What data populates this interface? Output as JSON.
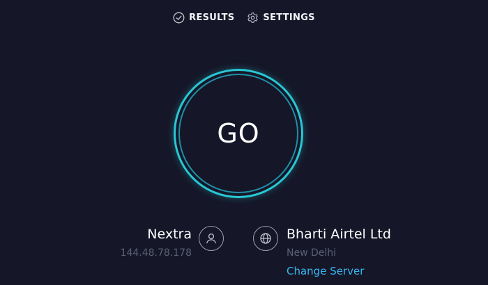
{
  "nav": {
    "results_label": "RESULTS",
    "settings_label": "SETTINGS",
    "results_icon": "check-circle-icon",
    "settings_icon": "gear-icon"
  },
  "go_button": {
    "label": "GO"
  },
  "client": {
    "isp_name": "Nextra",
    "ip_address": "144.48.78.178",
    "icon": "user-icon"
  },
  "server": {
    "name": "Bharti Airtel Ltd",
    "location": "New Delhi",
    "change_label": "Change Server",
    "icon": "globe-icon"
  },
  "colors": {
    "background": "#151728",
    "accent_ring": "#29c7d3",
    "link": "#38b6f2",
    "muted_text": "#5c5f72"
  }
}
